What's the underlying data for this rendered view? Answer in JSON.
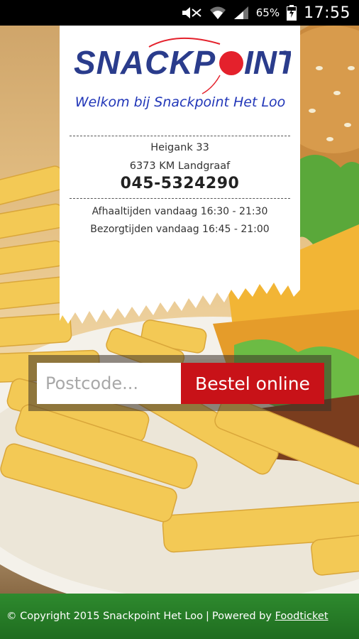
{
  "status_bar": {
    "icons": [
      "mute-icon",
      "wifi-icon",
      "signal-icon",
      "battery-icon"
    ],
    "battery_percent": "65%",
    "time": "17:55"
  },
  "receipt": {
    "logo_text": "SNACKPOINT",
    "welcome": "Welkom bij Snackpoint Het Loo",
    "address_line1": "Heigank 33",
    "address_line2": "6373 KM Landgraaf",
    "phone": "045-5324290",
    "pickup_hours": "Afhaaltijden vandaag 16:30 - 21:30",
    "delivery_hours": "Bezorgtijden vandaag 16:45 - 21:00"
  },
  "order": {
    "postcode_placeholder": "Postcode...",
    "postcode_value": "",
    "button_label": "Bestel online"
  },
  "footer": {
    "copyright": "© Copyright 2015 Snackpoint Het Loo",
    "separator": "|",
    "powered_by": "Powered by",
    "link_label": "Foodticket"
  },
  "colors": {
    "welcome_text": "#2136b8",
    "logo_red": "#e4212c",
    "logo_blue": "#2a3c8c",
    "button": "#c81218",
    "footer": "#2e8a2e"
  }
}
